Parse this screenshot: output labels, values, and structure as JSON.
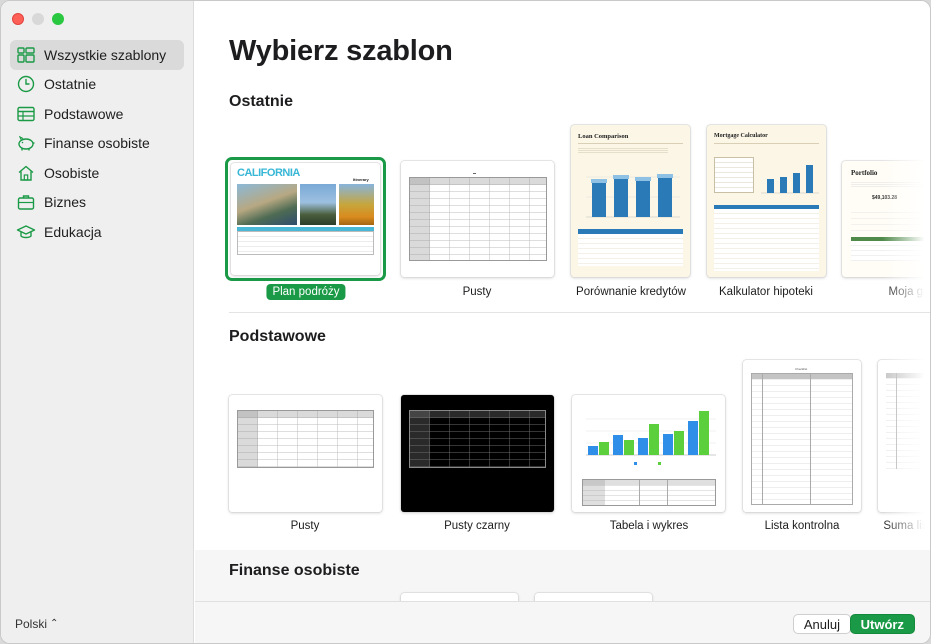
{
  "sidebar": {
    "items": [
      {
        "label": "Wszystkie szablony",
        "icon": "templates-grid-icon"
      },
      {
        "label": "Ostatnie",
        "icon": "clock-icon"
      },
      {
        "label": "Podstawowe",
        "icon": "table-icon"
      },
      {
        "label": "Finanse osobiste",
        "icon": "piggy-bank-icon"
      },
      {
        "label": "Osobiste",
        "icon": "house-icon"
      },
      {
        "label": "Biznes",
        "icon": "briefcase-icon"
      },
      {
        "label": "Edukacja",
        "icon": "graduation-cap-icon"
      }
    ],
    "language": "Polski"
  },
  "main": {
    "title": "Wybierz szablon",
    "sections": [
      {
        "title": "Ostatnie",
        "templates": [
          {
            "label": "Plan podróży",
            "selected": true,
            "thumb_title": "CALIFORNIA",
            "thumb_subtitle": "Itinerary"
          },
          {
            "label": "Pusty"
          },
          {
            "label": "Porównanie kredytów",
            "thumb_title": "Loan Comparison"
          },
          {
            "label": "Kalkulator hipoteki",
            "thumb_title": "Mortgage Calculator"
          },
          {
            "label": "Moja ga",
            "thumb_title": "Portfolio",
            "thumb_value": "$49,103.28"
          }
        ]
      },
      {
        "title": "Podstawowe",
        "templates": [
          {
            "label": "Pusty"
          },
          {
            "label": "Pusty czarny"
          },
          {
            "label": "Tabela i wykres"
          },
          {
            "label": "Lista kontrolna",
            "thumb_title": "Checklist"
          },
          {
            "label": "Suma list"
          }
        ]
      },
      {
        "title": "Finanse osobiste",
        "templates": []
      }
    ]
  },
  "footer": {
    "cancel_label": "Anuluj",
    "create_label": "Utwórz"
  },
  "colors": {
    "accent": "#1a9a46",
    "chart_blue": "#2f8fe8",
    "chart_green": "#5ccf3d",
    "loan_bar": "#2a7ab8"
  }
}
